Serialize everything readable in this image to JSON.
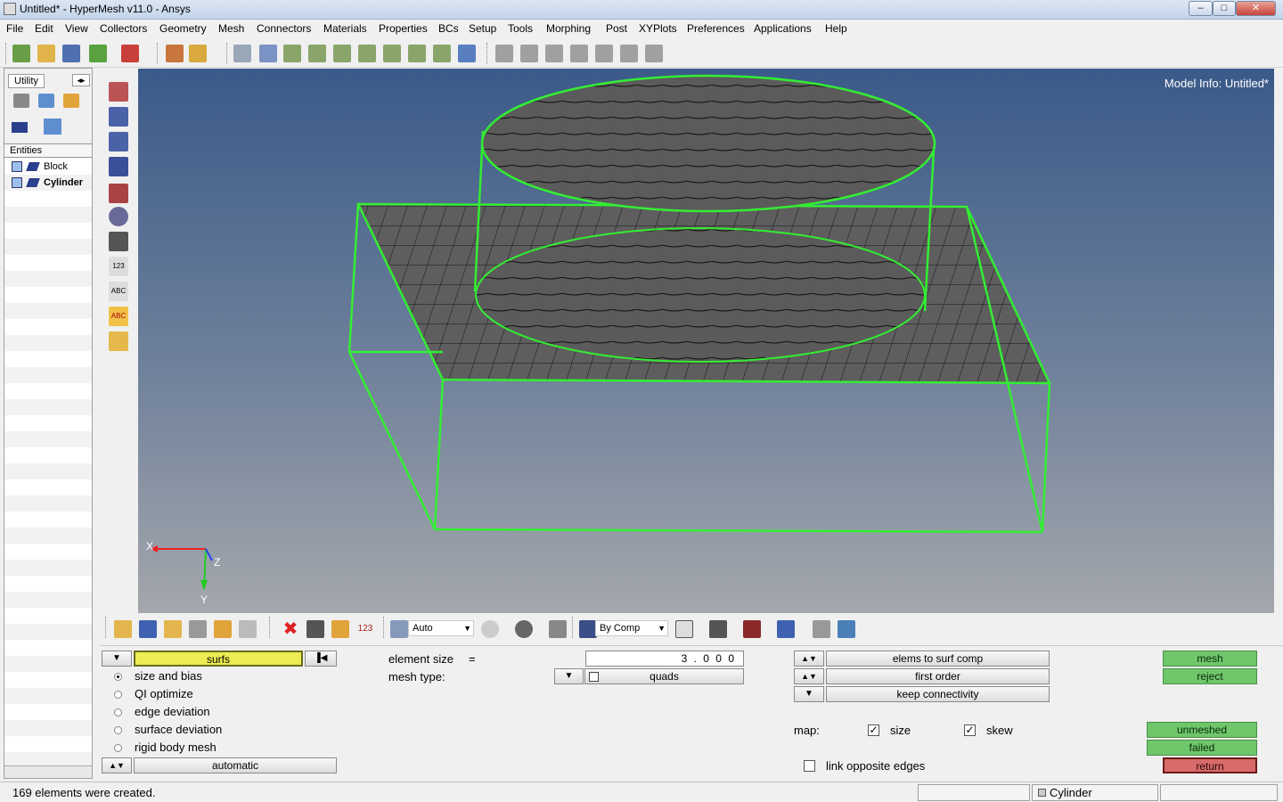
{
  "window": {
    "title": "Untitled* - HyperMesh v11.0 - Ansys",
    "controls": {
      "minimize": "–",
      "maximize": "□",
      "close": "✕"
    }
  },
  "menubar": [
    "File",
    "Edit",
    "View",
    "Collectors",
    "Geometry",
    "Mesh",
    "Connectors",
    "Materials",
    "Properties",
    "BCs",
    "Setup",
    "Tools",
    "Morphing",
    "Post",
    "XYPlots",
    "Preferences",
    "Applications",
    "Help"
  ],
  "browser": {
    "tab_label": "Utility",
    "entities_header": "Entities",
    "entities": [
      {
        "label": "Block"
      },
      {
        "label": "Cylinder"
      }
    ]
  },
  "graphics": {
    "model_info": "Model Info: Untitled*",
    "triad": {
      "x": "X",
      "y": "Y",
      "z": "Z"
    },
    "colors": {
      "edge": "#33ee33",
      "mesh_fill": "#5e5e5e",
      "mesh_line": "#111111"
    }
  },
  "lower_toolbar": {
    "auto_select": "Auto",
    "color_mode_select": "By Comp"
  },
  "panel": {
    "entity_selector": "surfs",
    "options": [
      {
        "label": "size and bias",
        "selected": true
      },
      {
        "label": "QI optimize",
        "selected": false
      },
      {
        "label": "edge deviation",
        "selected": false
      },
      {
        "label": "surface deviation",
        "selected": false
      },
      {
        "label": "rigid body mesh",
        "selected": false
      }
    ],
    "mode_toggle": "automatic",
    "element_size_label": "element size",
    "element_size_eq": "=",
    "element_size_value": "3 . 0 0 0",
    "mesh_type_label": "mesh type:",
    "mesh_type_value": "quads",
    "toggle_1": "elems to surf comp",
    "toggle_2": "first order",
    "toggle_3": "keep connectivity",
    "map_label": "map:",
    "map_size_label": "size",
    "map_size_checked": true,
    "map_skew_label": "skew",
    "map_skew_checked": true,
    "link_opposite_edges_label": "link opposite edges",
    "link_opposite_edges_checked": false,
    "buttons": {
      "mesh": "mesh",
      "reject": "reject",
      "unmeshed": "unmeshed",
      "failed": "failed",
      "return": "return"
    }
  },
  "statusbar": {
    "message": "169 elements were created.",
    "current_component": "Cylinder"
  }
}
